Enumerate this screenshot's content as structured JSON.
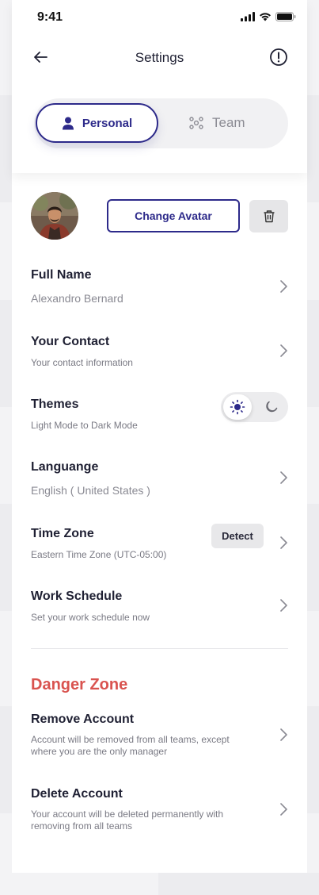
{
  "status": {
    "time": "9:41"
  },
  "header": {
    "title": "Settings"
  },
  "tabs": [
    {
      "label": "Personal",
      "icon": "person-icon",
      "active": true
    },
    {
      "label": "Team",
      "icon": "team-icon",
      "active": false
    }
  ],
  "avatar": {
    "change_label": "Change Avatar"
  },
  "settings": [
    {
      "title": "Full Name",
      "subtitle": "Alexandro Bernard"
    },
    {
      "title": "Your Contact",
      "subtitle": "Your contact information"
    },
    {
      "title": "Themes",
      "subtitle": "Light Mode to Dark Mode",
      "mode": "light"
    },
    {
      "title": "Languange",
      "subtitle": "English ( United States )"
    },
    {
      "title": "Time Zone",
      "subtitle": "Eastern Time Zone (UTC-05:00)",
      "action_label": "Detect"
    },
    {
      "title": "Work Schedule",
      "subtitle": "Set your work schedule now"
    }
  ],
  "danger": {
    "title": "Danger Zone",
    "items": [
      {
        "title": "Remove Account",
        "subtitle": "Account will be removed from all teams, except where you are the only manager"
      },
      {
        "title": "Delete Account",
        "subtitle": "Your account will be deleted permanently with removing from all teams"
      }
    ]
  },
  "colors": {
    "accent": "#2d2a8a",
    "danger": "#d9534f"
  }
}
